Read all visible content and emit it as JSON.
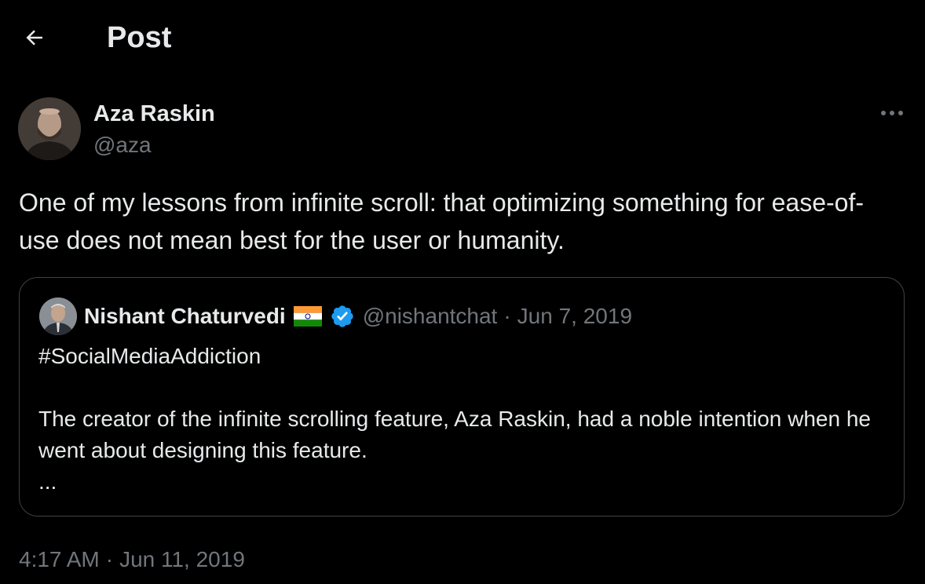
{
  "header": {
    "title": "Post",
    "back_icon": "arrow-left-icon"
  },
  "post": {
    "author_name": "Aza Raskin",
    "author_handle": "@aza",
    "text": "One of my lessons from infinite scroll: that optimizing something for ease-of-use does not mean best for the user or humanity.",
    "more_icon": "more-horizontal-icon",
    "time": "4:17 AM",
    "separator": "·",
    "date": "Jun 11, 2019"
  },
  "quote": {
    "author_name": "Nishant Chaturvedi",
    "flag_icon": "india-flag-icon",
    "verified_icon": "verified-badge-icon",
    "author_handle": "@nishantchat",
    "separator": "·",
    "date": "Jun 7, 2019",
    "hashtag": "#SocialMediaAddiction",
    "text": "The creator of the infinite scrolling feature, Aza Raskin, had a noble intention when he went about designing this feature.",
    "ellipsis": "..."
  },
  "colors": {
    "background": "#000000",
    "text_primary": "#e7e9ea",
    "text_secondary": "#71767b",
    "border": "#3e4144",
    "verified_blue": "#1d9bf0"
  }
}
